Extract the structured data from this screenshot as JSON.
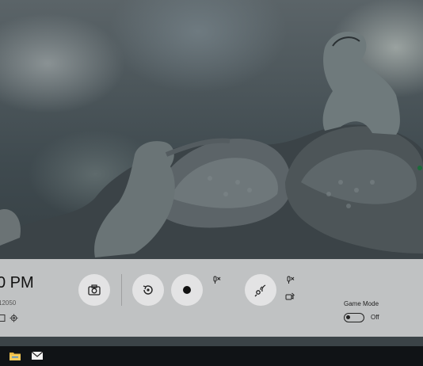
{
  "gamebar": {
    "time": "0 PM",
    "build": "12050",
    "buttons": {
      "screenshot": "screenshot-button",
      "record_last": "record-last-button",
      "record": "record-button",
      "broadcast": "broadcast-button"
    },
    "game_mode": {
      "label": "Game Mode",
      "state": "Off"
    }
  },
  "taskbar": {
    "items": [
      "file-explorer-icon",
      "mail-icon"
    ]
  },
  "colors": {
    "overlay": "#e2e2e2",
    "taskbar": "#101316"
  }
}
